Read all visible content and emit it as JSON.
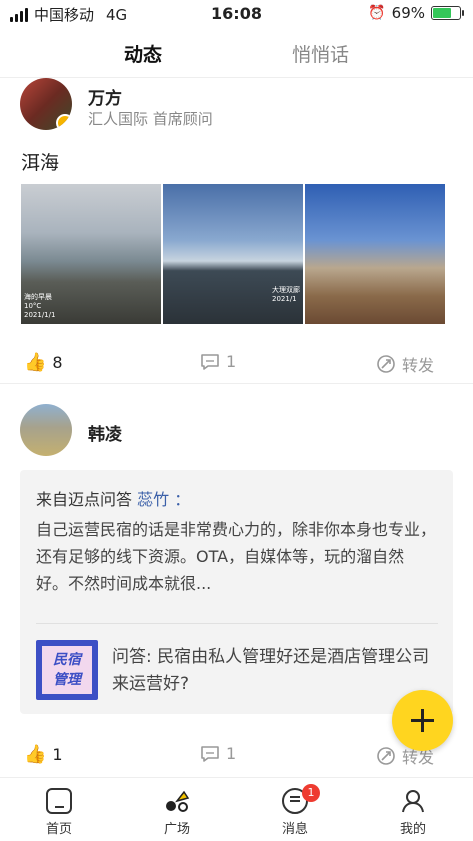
{
  "status_bar": {
    "carrier": "中国移动",
    "network": "4G",
    "time": "16:08",
    "battery_pct": "69%",
    "battery_level": 0.69
  },
  "tabs": [
    {
      "label": "动态",
      "active": true
    },
    {
      "label": "悄悄话",
      "active": false
    }
  ],
  "post1": {
    "author": "万方",
    "subtitle": "汇人国际 首席顾问",
    "text": "洱海",
    "photos": [
      {
        "caption": "海的早晨\n10°C\n2021/1/1"
      },
      {
        "caption": "大理双廊\n2021/1"
      },
      {
        "caption": ""
      }
    ],
    "likes": "8",
    "comments": "1",
    "share_label": "转发"
  },
  "post2": {
    "author": "韩凌",
    "quote_source_prefix": "来自迈点问答",
    "quote_source_name": "蕊竹",
    "quote_source_suffix": "：",
    "quote_body": "自己运营民宿的话是非常费心力的，除非你本身也专业，还有足够的线下资源。OTA，自媒体等，玩的溜自然好。不然时间成本就很...",
    "thumb_text": "民宿\n管理",
    "quote_title": "问答: 民宿由私人管理好还是酒店管理公司来运营好?",
    "likes": "1",
    "comments": "1",
    "share_label": "转发"
  },
  "bottom_nav": [
    {
      "label": "首页",
      "icon": "home-icon"
    },
    {
      "label": "广场",
      "icon": "square-icon"
    },
    {
      "label": "消息",
      "icon": "message-icon",
      "badge": "1"
    },
    {
      "label": "我的",
      "icon": "profile-icon"
    }
  ],
  "colors": {
    "accent": "#ffd51f",
    "link": "#3a5fa8",
    "badge": "#ee3b30"
  }
}
